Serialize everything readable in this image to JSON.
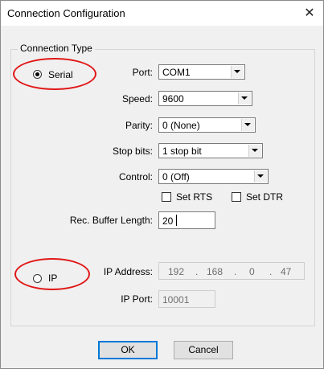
{
  "window": {
    "title": "Connection Configuration",
    "close_glyph": "✕"
  },
  "group": {
    "legend": "Connection Type"
  },
  "serial": {
    "radio_label": "Serial",
    "selected": true,
    "port_label": "Port:",
    "port_value": "COM1",
    "speed_label": "Speed:",
    "speed_value": "9600",
    "parity_label": "Parity:",
    "parity_value": "0 (None)",
    "stopbits_label": "Stop bits:",
    "stopbits_value": "1 stop bit",
    "control_label": "Control:",
    "control_value": "0 (Off)",
    "set_rts_label": "Set RTS",
    "set_rts_checked": false,
    "set_dtr_label": "Set DTR",
    "set_dtr_checked": false,
    "buffer_label": "Rec. Buffer Length:",
    "buffer_value": "20"
  },
  "ip": {
    "radio_label": "IP",
    "selected": false,
    "address_label": "IP Address:",
    "octets": [
      "192",
      "168",
      "0",
      "47"
    ],
    "dot": ".",
    "port_label": "IP Port:",
    "port_value": "10001"
  },
  "buttons": {
    "ok": "OK",
    "cancel": "Cancel"
  },
  "colors": {
    "annotation": "#e11616",
    "default_button_border": "#0078d7"
  },
  "icons": {
    "dropdown": "chevron-down-icon",
    "close": "close-icon"
  }
}
